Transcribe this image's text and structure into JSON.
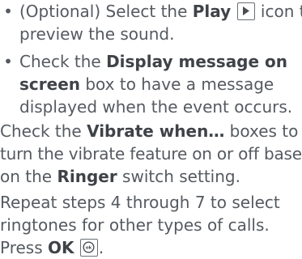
{
  "bullets": [
    {
      "prefix": "(Optional) Select the ",
      "bold": "Play",
      "icon": "play-icon",
      "suffix_line1": " icon to",
      "line2": "preview the sound."
    },
    {
      "prefix": "Check the ",
      "bold_line1": "Display message on",
      "bold_line2": "screen",
      "suffix_line2": " box to have a message",
      "line3": "displayed when the event occurs."
    }
  ],
  "step_vibrate": {
    "prefix": "Check the ",
    "bold1": "Vibrate when…",
    "mid1": " boxes to",
    "line2": "turn the vibrate feature on or off based",
    "line3_prefix": "on the ",
    "bold2": "Ringer",
    "line3_suffix": " switch setting."
  },
  "step_repeat": {
    "line1": "Repeat steps 4 through 7 to select",
    "line2": "ringtones for other types of calls."
  },
  "step_ok": {
    "prefix": "Press ",
    "bold": "OK",
    "icon": "ok-key-icon",
    "suffix": "."
  },
  "colors": {
    "text": "#555a60",
    "bold_text": "#3f4348"
  }
}
